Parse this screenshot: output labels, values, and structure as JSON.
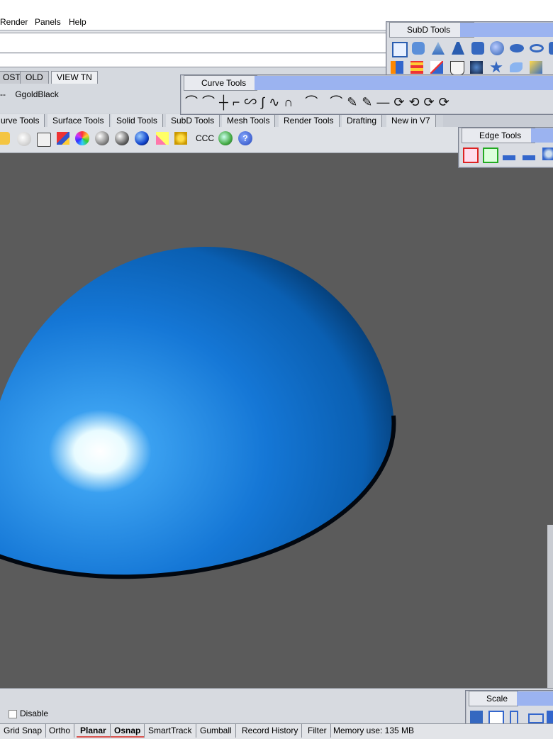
{
  "menu": {
    "items": [
      "Render",
      "Panels",
      "Help"
    ]
  },
  "view_tabs": [
    "OST",
    "OLD",
    "VIEW TN"
  ],
  "view_name": "GgoldBlack",
  "view_name_prefix": "--",
  "tool_tabs": [
    "urve Tools",
    "Surface Tools",
    "Solid Tools",
    "SubD Tools",
    "Mesh Tools",
    "Render Tools",
    "Drafting",
    "New in V7"
  ],
  "panels": {
    "subd_tools": {
      "title": "SubD Tools"
    },
    "curve_tools": {
      "title": "Curve Tools"
    },
    "edge_tools": {
      "title": "Edge Tools"
    },
    "scale": {
      "title": "Scale"
    }
  },
  "toolbar": {
    "ccc_label": "CCC"
  },
  "disable_label": "Disable",
  "status": {
    "items": [
      {
        "label": "Grid Snap",
        "bold": false,
        "underline": false
      },
      {
        "label": "Ortho",
        "bold": false,
        "underline": false
      },
      {
        "label": "Planar",
        "bold": true,
        "underline": true
      },
      {
        "label": "Osnap",
        "bold": true,
        "underline": true
      },
      {
        "label": "SmartTrack",
        "bold": false,
        "underline": false
      },
      {
        "label": "Gumball",
        "bold": false,
        "underline": false
      },
      {
        "label": "Record History",
        "bold": false,
        "underline": false
      },
      {
        "label": "Filter",
        "bold": false,
        "underline": false
      }
    ],
    "memory": "Memory use: 135 MB"
  },
  "colors": {
    "viewport_bg": "#5b5b5b",
    "sphere_blue": "#1b78cc",
    "panel_title_fill": "#9bb3f0"
  },
  "icons": {
    "subd": [
      "subd-box-icon",
      "subd-cylinder-icon",
      "subd-cone-icon",
      "subd-tcone-icon",
      "subd-barrel-icon",
      "subd-sphere-icon",
      "subd-ellipsoid-icon",
      "subd-torus-icon",
      "subd-extra-icon",
      "subd-bar-icon",
      "subd-grid-icon",
      "subd-star-icon",
      "subd-cup-icon",
      "subd-twist-icon",
      "subd-starshape-icon",
      "subd-leaf-icon",
      "subd-gem-icon"
    ],
    "curve": [
      "fillet-curves-icon",
      "blend-curves-icon",
      "extend-curve-icon",
      "offset-curve-icon",
      "rebuild-curve-icon",
      "adjust-ends-icon",
      "fair-curve-icon",
      "arch-icon",
      "curve-from-2-views-icon",
      "project-icon",
      "pull-icon",
      "split-icon",
      "sketch-icon",
      "dash-icon",
      "rotate-icon",
      "refit-icon",
      "match-icon",
      "more-icon"
    ],
    "edge": [
      "edge-box-red-icon",
      "edge-box-green-icon",
      "edge-split-icon",
      "edge-merge-icon",
      "edge-settings-icon"
    ],
    "main": [
      "sun-icon",
      "light-bulb-icon",
      "lock-icon",
      "layer-icon",
      "color-wheel-icon",
      "material-sphere-icon",
      "render-sphere-icon",
      "blue-sphere-icon",
      "spotlight-icon",
      "gear-cluster-icon",
      "ccc-icon",
      "globe-icon",
      "help-icon"
    ]
  }
}
